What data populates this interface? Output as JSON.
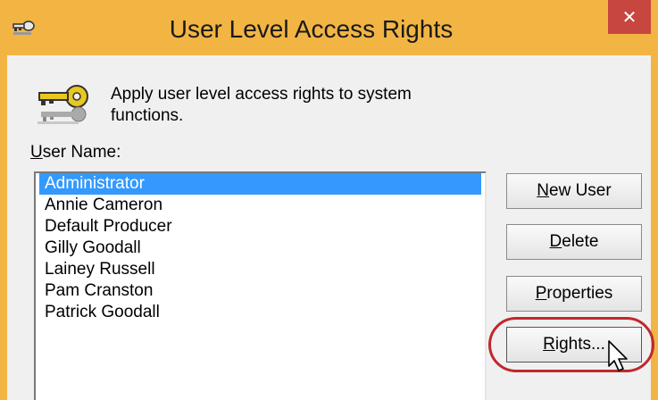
{
  "window": {
    "title": "User Level Access Rights",
    "title_icon": "key-icon",
    "close_label": "✕"
  },
  "description": {
    "icon": "keys-icon",
    "text": "Apply user level access rights to system functions."
  },
  "user_list": {
    "label_accel": "U",
    "label_rest": "ser Name:",
    "items": [
      "Administrator",
      "Annie Cameron",
      "Default Producer",
      "Gilly Goodall",
      "Lainey Russell",
      "Pam Cranston",
      "Patrick Goodall"
    ],
    "selected_item": "Administrator"
  },
  "buttons": {
    "new_user": {
      "accel": "N",
      "rest": "ew User"
    },
    "delete": {
      "accel": "D",
      "rest": "elete"
    },
    "properties": {
      "accel": "P",
      "rest": "roperties"
    },
    "rights": {
      "accel": "R",
      "rest": "ights..."
    }
  },
  "colors": {
    "titlebar": "#f2b544",
    "close_button": "#c7463f",
    "selection": "#3399ff",
    "highlight_ring": "#c0282d"
  }
}
